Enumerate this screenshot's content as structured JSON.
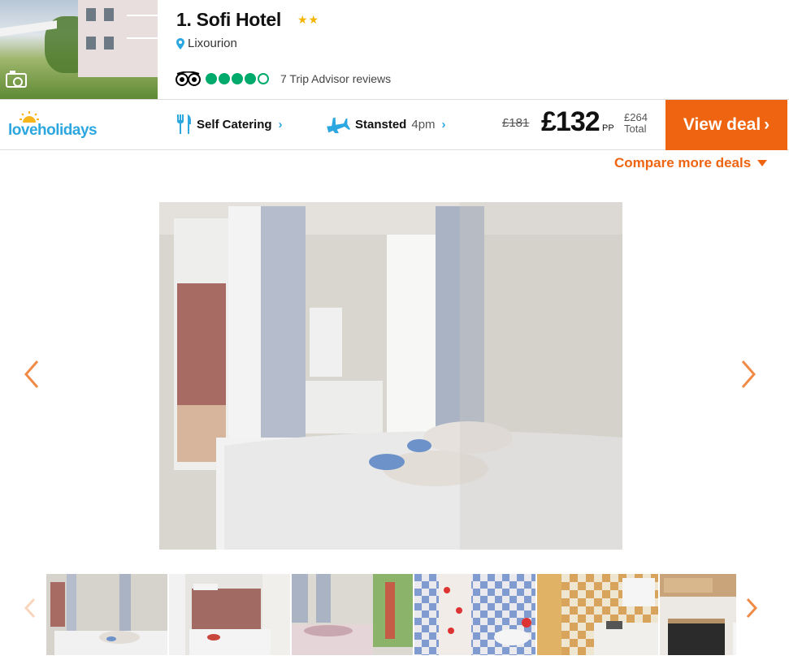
{
  "listing": {
    "title": "1. Sofi Hotel",
    "stars": "★★",
    "location": "Lixourion",
    "tripadvisor": {
      "rating_bubbles": 4.5,
      "reviews_text": "7 Trip Advisor reviews"
    }
  },
  "deal": {
    "provider_logo_text": "loveholidays",
    "board_type": "Self Catering",
    "departure_airport": "Stansted",
    "departure_time": "4pm",
    "old_price": "£181",
    "price": "£132",
    "price_suffix": "PP",
    "total_price": "£264",
    "total_label": "Total",
    "cta_label": "View deal",
    "compare_label": "Compare more deals"
  },
  "gallery": {
    "thumbnail_count": 6
  },
  "icons": {
    "camera": "camera-icon",
    "pin": "map-pin-icon",
    "tripadvisor": "tripadvisor-owl-icon",
    "board": "cutlery-icon",
    "flight": "plane-icon",
    "prev": "chevron-left-icon",
    "next": "chevron-right-icon"
  },
  "colors": {
    "accent_orange": "#ee6411",
    "brand_blue": "#2da7df",
    "tripadvisor_green": "#00aa6c",
    "star_yellow": "#f4b400"
  }
}
